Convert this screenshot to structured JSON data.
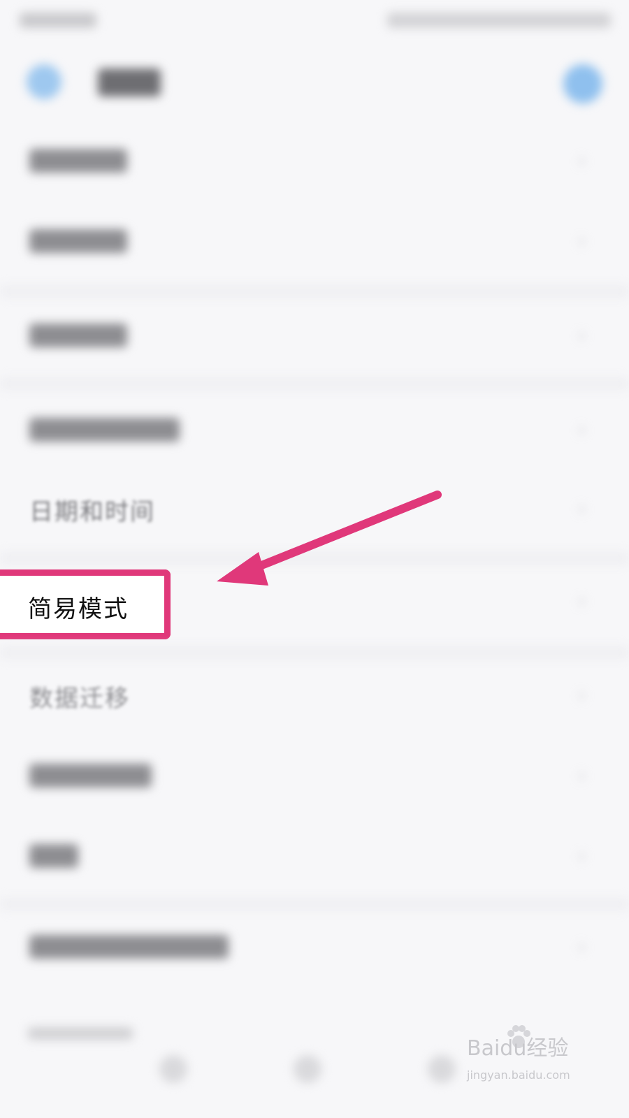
{
  "settings_list": {
    "items": [
      {
        "label": "日期和时间"
      },
      {
        "label": "简易模式"
      },
      {
        "label": "数据迁移"
      }
    ]
  },
  "annotation": {
    "highlight_color": "#e0387a",
    "arrow_color": "#e0387a"
  },
  "watermark": {
    "brand": "Baidu经验",
    "url": "jingyan.baidu.com"
  }
}
